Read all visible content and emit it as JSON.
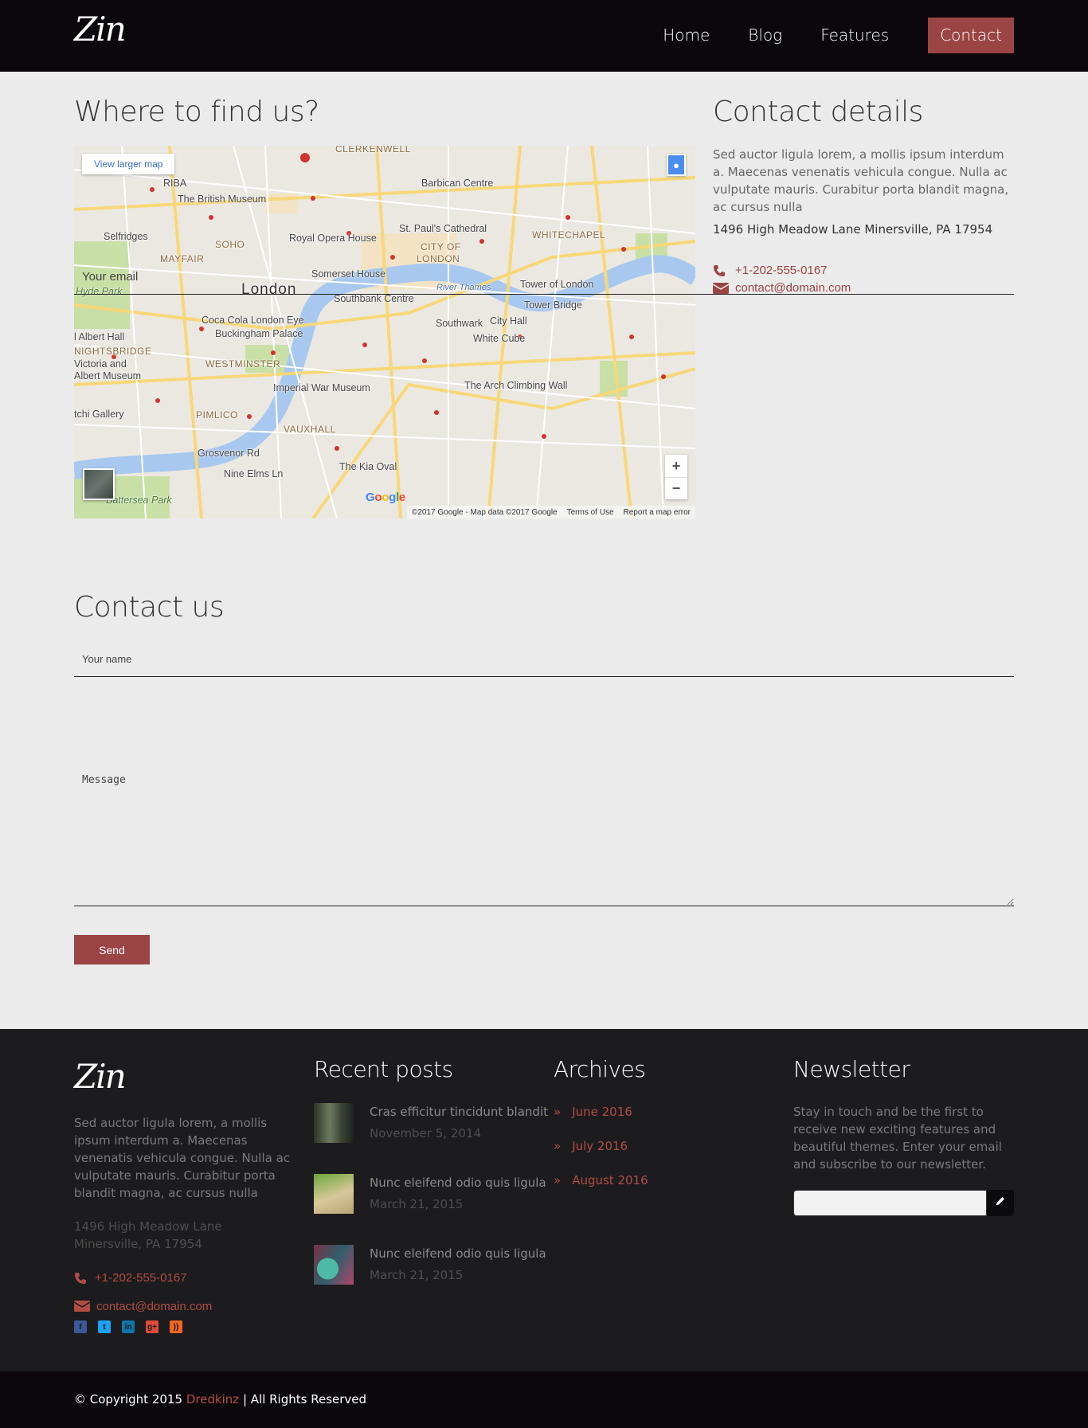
{
  "header": {
    "logo": "Zin",
    "nav": [
      {
        "label": "Home"
      },
      {
        "label": "Blog"
      },
      {
        "label": "Features"
      },
      {
        "label": "Contact"
      }
    ]
  },
  "find": {
    "title": "Where to find us?",
    "map": {
      "view_larger": "View larger map",
      "attribution": "©2017 Google - Map data ©2017 Google",
      "terms": "Terms of Use",
      "report": "Report a map error",
      "google": "Google",
      "zoom_in": "+",
      "zoom_out": "−",
      "labels": {
        "clerkenwell": "CLERKENWELL",
        "riba": "RIBA",
        "british_museum": "The British Museum",
        "barbican": "Barbican Centre",
        "selfridges": "Selfridges",
        "soho": "SOHO",
        "royal_opera": "Royal Opera House",
        "st_pauls": "St. Paul's Cathedral",
        "city_of": "CITY OF",
        "london_city": "LONDON",
        "whitechapel": "WHITECHAPEL",
        "mayfair": "MAYFAIR",
        "somerset": "Somerset House",
        "london": "London",
        "tower_london": "Tower of London",
        "hyde_park": "Hyde Park",
        "southbank": "Southbank Centre",
        "tower_bridge": "Tower Bridge",
        "coca_cola": "Coca Cola London Eye",
        "southwark": "Southwark",
        "city_hall": "City Hall",
        "albert_hall": "l Albert Hall",
        "buckingham": "Buckingham Palace",
        "white_cube": "White Cube",
        "knightsbridge": "NIGHTSBRIDGE",
        "westminster": "WESTMINSTER",
        "victoria_albert": "Victoria and",
        "albert_museum": "Albert Museum",
        "imperial_war": "Imperial War Museum",
        "arch_climbing": "The Arch Climbing Wall",
        "gallery": "tchi Gallery",
        "pimlico": "PIMLICO",
        "vauxhall": "VAUXHALL",
        "grosvenor": "Grosvenor Rd",
        "kia_oval": "The Kia Oval",
        "nine_elms": "Nine Elms Ln",
        "battersea": "Battersea Park",
        "river_thames": "River Thames"
      }
    }
  },
  "details": {
    "title": "Contact details",
    "text": "Sed auctor ligula lorem, a mollis ipsum interdum a. Maecenas venenatis vehicula congue. Nulla ac vulputate mauris. Curabitur porta blandit magna, ac cursus nulla",
    "address": "1496 High Meadow Lane Minersville, PA 17954",
    "phone": "+1-202-555-0167",
    "email": "contact@domain.com"
  },
  "form": {
    "title": "Contact us",
    "name_placeholder": "Your name",
    "email_placeholder": "Your email",
    "message_placeholder": "Message",
    "send": "Send"
  },
  "footer": {
    "logo": "Zin",
    "about": "Sed auctor ligula lorem, a mollis ipsum interdum a. Maecenas venenatis vehicula congue. Nulla ac vulputate mauris. Curabitur porta blandit magna, ac cursus nulla",
    "address": "1496 High Meadow Lane Minersville, PA 17954",
    "phone": "+1-202-555-0167",
    "email": "contact@domain.com",
    "social": [
      {
        "icon": "facebook-icon",
        "glyph": "f",
        "color": "#3b5998"
      },
      {
        "icon": "twitter-icon",
        "glyph": "t",
        "color": "#1da1f2"
      },
      {
        "icon": "linkedin-icon",
        "glyph": "in",
        "color": "#0e76a8"
      },
      {
        "icon": "google-plus-icon",
        "glyph": "g+",
        "color": "#dd4b39"
      },
      {
        "icon": "rss-icon",
        "glyph": "))",
        "color": "#f26522"
      }
    ],
    "recent_title": "Recent posts",
    "posts": [
      {
        "title": "Cras efficitur tincidunt blandit",
        "date": "November 5, 2014"
      },
      {
        "title": "Nunc eleifend odio quis ligula",
        "date": "March 21, 2015"
      },
      {
        "title": "Nunc eleifend odio quis ligula",
        "date": "March 21, 2015"
      }
    ],
    "archives_title": "Archives",
    "archives": [
      {
        "label": "June 2016"
      },
      {
        "label": "July 2016"
      },
      {
        "label": "August 2016"
      }
    ],
    "archive_marker": "»",
    "newsletter_title": "Newsletter",
    "newsletter_text": "Stay in touch and be the first to receive new exciting features and beautiful themes. Enter your email and subscribe to our newsletter."
  },
  "copyright": {
    "prefix": "© Copyright 2015",
    "brand": "Dredkinz",
    "suffix": "| All Rights Reserved"
  },
  "colors": {
    "accent": "#9b4444",
    "header_bg": "#0b070c",
    "footer_bg": "#1c1b1e"
  }
}
